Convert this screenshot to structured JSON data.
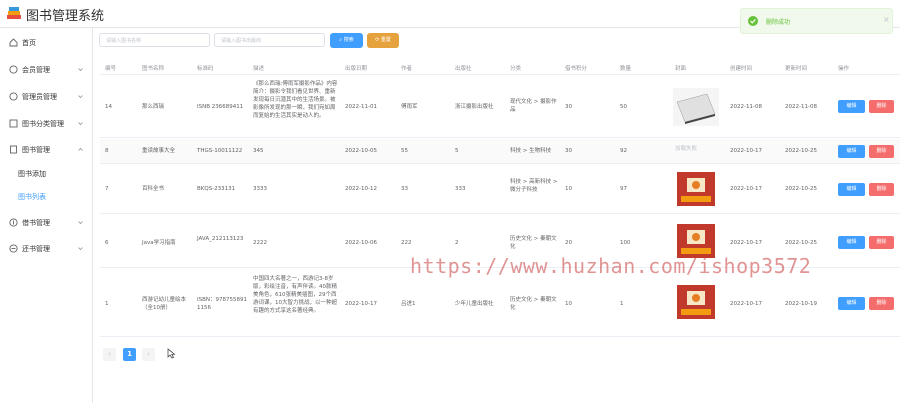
{
  "header": {
    "title": "图书管理系统",
    "logo": "book-stack-logo",
    "accent_color": "#409eff"
  },
  "sidebar": {
    "items": [
      {
        "label": "首页",
        "icon": "home-icon"
      },
      {
        "label": "会员管理",
        "icon": "user-icon"
      },
      {
        "label": "管理员管理",
        "icon": "user-icon"
      },
      {
        "label": "图书分类管理",
        "icon": "category-icon"
      },
      {
        "label": "图书管理",
        "icon": "book-icon"
      },
      {
        "label": "借书管理",
        "icon": "borrow-icon"
      },
      {
        "label": "还书管理",
        "icon": "return-icon"
      }
    ],
    "sub_items": [
      {
        "label": "图书添加"
      },
      {
        "label": "图书列表"
      }
    ]
  },
  "toolbar": {
    "name_placeholder": "请输入图书名称",
    "publisher_placeholder": "请输入图书出版商",
    "search_label": "搜索",
    "reset_label": "重置"
  },
  "table": {
    "headers": [
      "编号",
      "图书名称",
      "标准码",
      "描述",
      "出版日期",
      "作者",
      "出版社",
      "分类",
      "借书积分",
      "数量",
      "封面",
      "创建时间",
      "更新时间",
      "操作"
    ],
    "edit_label": "编辑",
    "delete_label": "删除",
    "rows": [
      {
        "id": "14",
        "name": "那么西瑞",
        "isbn": "ISNB 236689411",
        "desc": "《那么西瑞:傅雨军摄影作品》内容简介：摄影令我们看见世界、重新发现每日沉潜其中的生活场景。被影像所发现的那一瞬，我们宛如周而复始的生活其实是动人的。",
        "pub_date": "2022-11-01",
        "author": "傅雨军",
        "publisher": "浙江摄影出版社",
        "category": "现代文化 > 摄影作品",
        "points": "30",
        "qty": "50",
        "cover": "photo-book-cover",
        "created": "2022-11-08",
        "updated": "2022-11-08"
      },
      {
        "id": "8",
        "name": "重读故事大全",
        "isbn": "THGS-10011122",
        "desc": "345",
        "pub_date": "2022-10-05",
        "author": "55",
        "publisher": "5",
        "category": "科技 > 生物科技",
        "points": "30",
        "qty": "92",
        "cover": "加载失败",
        "created": "2022-10-17",
        "updated": "2022-10-25"
      },
      {
        "id": "7",
        "name": "百科全书",
        "isbn": "BKQS-233131",
        "desc": "3333",
        "pub_date": "2022-10-12",
        "author": "33",
        "publisher": "333",
        "category": "科技 > 高新科技 > 微分子科技",
        "points": "10",
        "qty": "97",
        "cover": "xiyouji-book-cover",
        "created": "2022-10-17",
        "updated": "2022-10-25"
      },
      {
        "id": "6",
        "name": "Java学习指南",
        "isbn": "JAVA_212113123",
        "desc": "2222",
        "pub_date": "2022-10-06",
        "author": "222",
        "publisher": "2",
        "category": "历史文化 > 秦朝文化",
        "points": "20",
        "qty": "100",
        "cover": "xiyouji-book-cover",
        "created": "2022-10-17",
        "updated": "2022-10-25"
      },
      {
        "id": "1",
        "name": "西游记幼儿童绘本（全10册）",
        "isbn": "ISBN：9787558911156",
        "desc": "中国四大名著之一，西游记3-8岁版，彩绘注音，有声伴读。40款精美角色，610张精美插图，29个西游词课，10大智力挑战，以一种超有趣的方式享这名著经典。",
        "pub_date": "2022-10-17",
        "author": "吕进1",
        "publisher": "少年儿童出版社",
        "category": "历史文化 > 秦朝文化",
        "points": "10",
        "qty": "1",
        "cover": "xiyouji-book-cover",
        "created": "2022-10-17",
        "updated": "2022-10-19"
      }
    ]
  },
  "pagination": {
    "current": "1"
  },
  "toast": {
    "message": "删除成功",
    "color": "#67c23a"
  },
  "watermark": {
    "text": "https://www.huzhan.com/ishop3572"
  }
}
